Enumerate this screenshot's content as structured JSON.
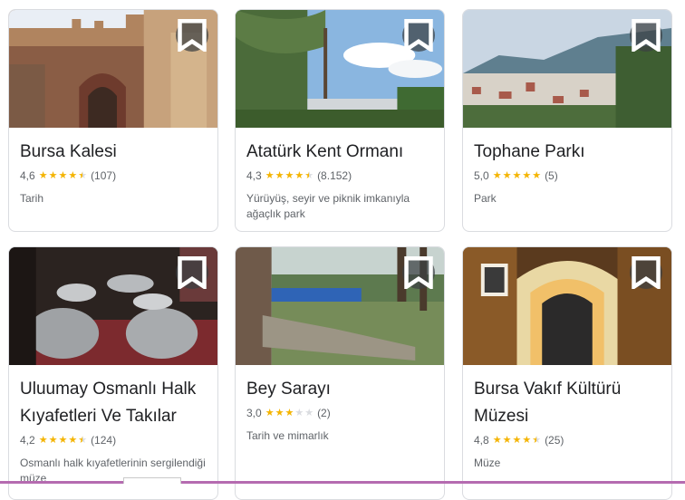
{
  "places": [
    {
      "name": "Bursa Kalesi",
      "rating": "4,6",
      "stars": 4.6,
      "reviews": "(107)",
      "category": "Tarih"
    },
    {
      "name": "Atatürk Kent Ormanı",
      "rating": "4,3",
      "stars": 4.3,
      "reviews": "(8.152)",
      "category": "Yürüyüş, seyir ve piknik imkanıyla ağaçlık park"
    },
    {
      "name": "Tophane Parkı",
      "rating": "5,0",
      "stars": 5.0,
      "reviews": "(5)",
      "category": "Park"
    },
    {
      "name": "Uluumay Osmanlı Halk Kıyafetleri Ve Takılar",
      "rating": "4,2",
      "stars": 4.2,
      "reviews": "(124)",
      "category": "Osmanlı halk kıyafetlerinin sergilendiği müze"
    },
    {
      "name": "Bey Sarayı",
      "rating": "3,0",
      "stars": 3.0,
      "reviews": "(2)",
      "category": "Tarih ve mimarlık"
    },
    {
      "name": "Bursa Vakıf Kültürü Müzesi",
      "rating": "4,8",
      "stars": 4.8,
      "reviews": "(25)",
      "category": "Müze"
    }
  ],
  "icons": {
    "save": "bookmark-icon",
    "star": "star-icon"
  },
  "colors": {
    "star": "#f4b400",
    "star_empty": "#dadce0"
  }
}
